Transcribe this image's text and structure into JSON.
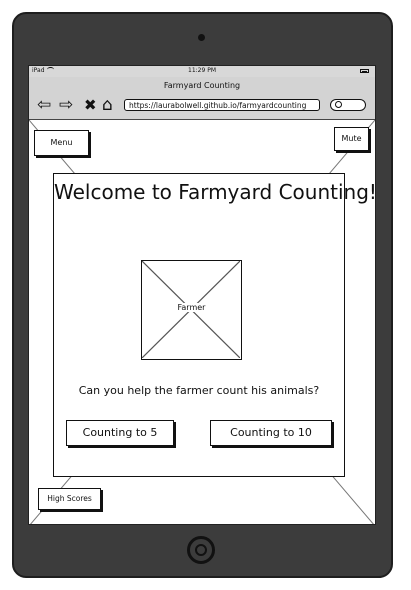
{
  "status_bar": {
    "carrier": "iPad",
    "time": "11:29 PM"
  },
  "browser": {
    "title": "Farmyard Counting",
    "url": "https://laurabolwell.github.io/farmyardcounting",
    "back_icon": "arrow-left",
    "forward_icon": "arrow-right",
    "close_icon": "x",
    "home_icon": "house"
  },
  "app": {
    "menu_label": "Menu",
    "mute_label": "Mute",
    "title": "Welcome to Farmyard Counting!",
    "image_label": "Farmer",
    "subtitle": "Can  you help the farmer count his animals?",
    "buttons": {
      "count5": "Counting to 5",
      "count10": "Counting to 10"
    },
    "high_scores_label": "High Scores"
  }
}
